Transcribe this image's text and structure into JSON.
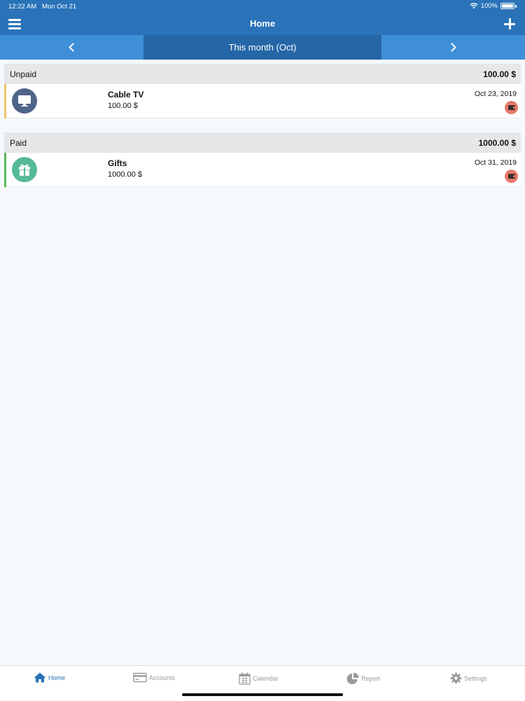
{
  "status_bar": {
    "time": "12:22 AM",
    "date": "Mon Oct 21",
    "battery": "100%"
  },
  "nav": {
    "title": "Home",
    "menu_icon": "hamburger-menu-icon",
    "add_icon": "plus-icon"
  },
  "period": {
    "label": "This month (Oct)",
    "prev_icon": "chevron-left-icon",
    "next_icon": "chevron-right-icon"
  },
  "sections": [
    {
      "title": "Unpaid",
      "total": "100.00 $",
      "accent_color": "#f2c26b",
      "items": [
        {
          "name": "Cable TV",
          "amount": "100.00 $",
          "date": "Oct 23, 2019",
          "icon": "tv-icon",
          "icon_color": "#4f6487",
          "account_icon": "wallet-icon"
        }
      ]
    },
    {
      "title": "Paid",
      "total": "1000.00 $",
      "accent_color": "#5cb85c",
      "items": [
        {
          "name": "Gifts",
          "amount": "1000.00 $",
          "date": "Oct 31, 2019",
          "icon": "gift-icon",
          "icon_color": "#55b99a",
          "account_icon": "wallet-icon"
        }
      ]
    }
  ],
  "tabbar": {
    "active": "Home",
    "tabs": [
      {
        "label": "Home",
        "icon": "home-icon"
      },
      {
        "label": "Accounts",
        "icon": "credit-card-icon"
      },
      {
        "label": "Calendar",
        "icon": "calendar-icon"
      },
      {
        "label": "Report",
        "icon": "pie-chart-icon"
      },
      {
        "label": "Settings",
        "icon": "gear-icon"
      }
    ]
  },
  "colors": {
    "header": "#2a73b9",
    "month_bar": "#3f8fd8",
    "month_center": "#2566a6",
    "background": "#f5f9fc"
  }
}
